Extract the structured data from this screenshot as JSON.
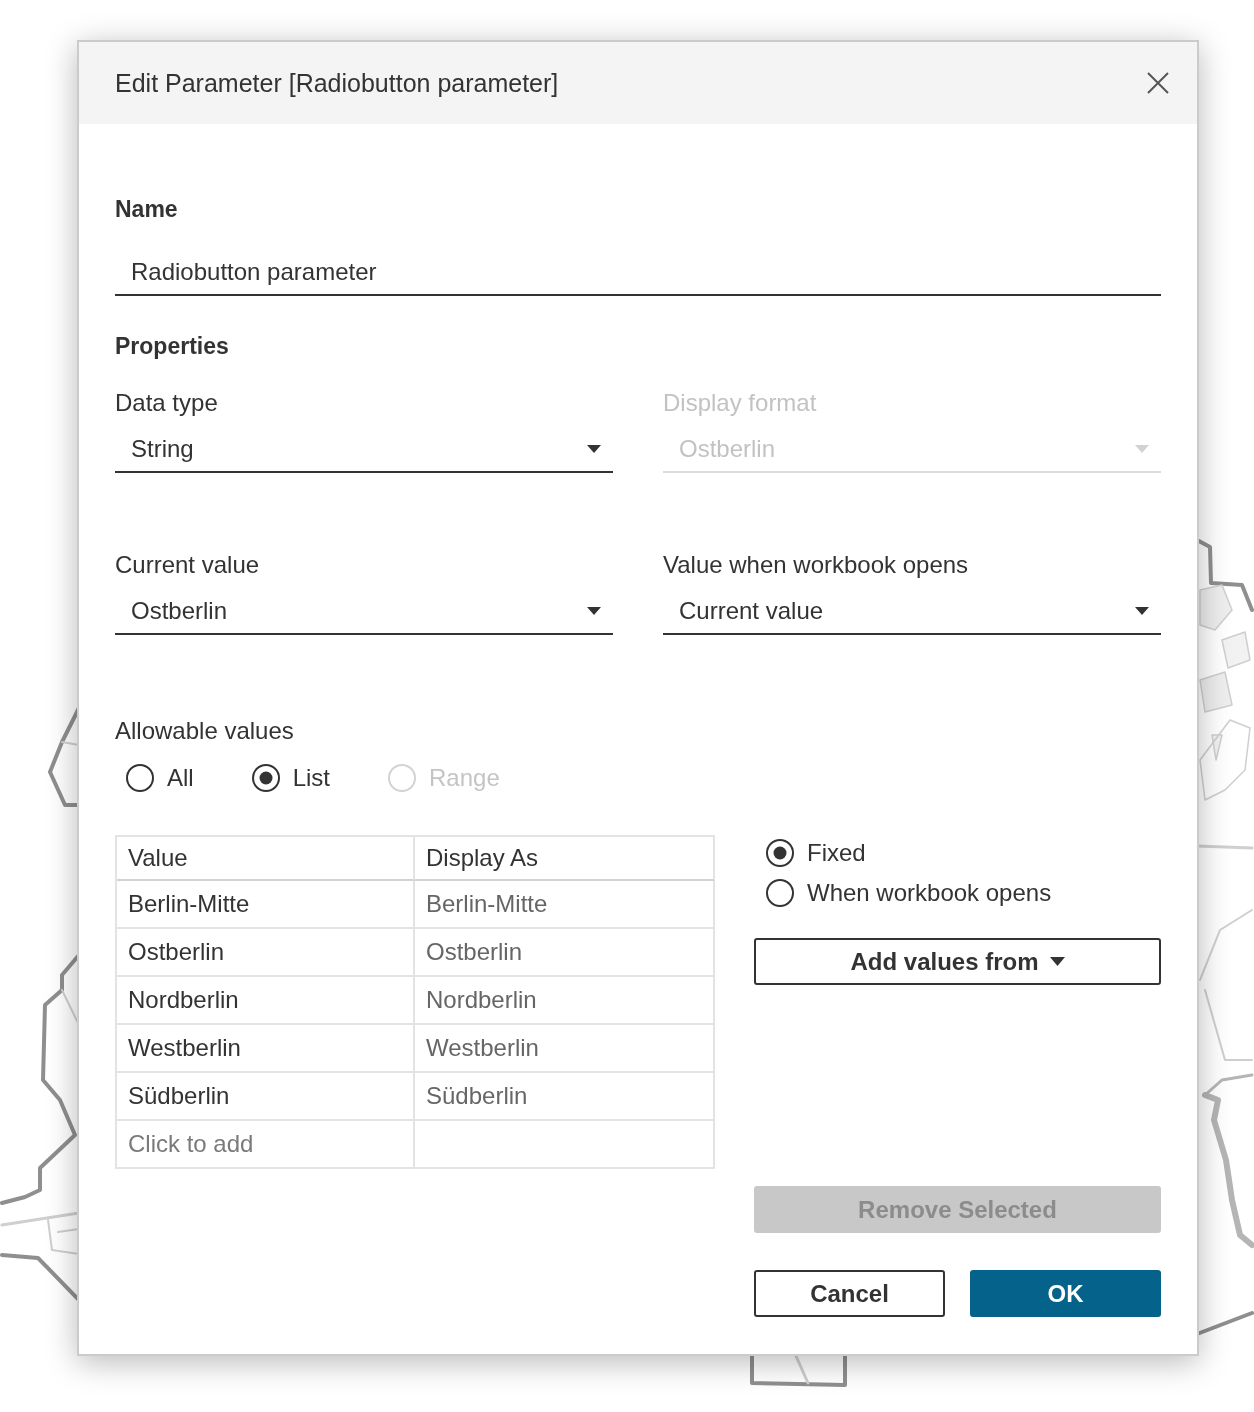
{
  "dialog": {
    "title": "Edit Parameter [Radiobutton parameter]"
  },
  "name_section": {
    "heading": "Name",
    "field": {
      "value": "Radiobutton parameter"
    }
  },
  "properties": {
    "heading": "Properties",
    "fields": [
      {
        "label": "Data type",
        "value": "String",
        "disabled": false
      },
      {
        "label": "Display format",
        "value": "Ostberlin",
        "disabled": true
      },
      {
        "label": "Current value",
        "value": "Ostberlin",
        "disabled": false
      },
      {
        "label": "Value when workbook opens",
        "value": "Current value",
        "disabled": false
      }
    ]
  },
  "allowable_values": {
    "label": "Allowable values",
    "options": [
      {
        "label": "All",
        "selected": false,
        "disabled": false
      },
      {
        "label": "List",
        "selected": true,
        "disabled": false
      },
      {
        "label": "Range",
        "selected": false,
        "disabled": true
      }
    ]
  },
  "table": {
    "columns": [
      "Value",
      "Display As"
    ],
    "rows": [
      {
        "value": "Berlin-Mitte",
        "display_as": "Berlin-Mitte"
      },
      {
        "value": "Ostberlin",
        "display_as": "Ostberlin"
      },
      {
        "value": "Nordberlin",
        "display_as": "Nordberlin"
      },
      {
        "value": "Westberlin",
        "display_as": "Westberlin"
      },
      {
        "value": "Südberlin",
        "display_as": "Südberlin"
      }
    ],
    "add_row": {
      "placeholder": "Click to add"
    }
  },
  "list_source": {
    "options": [
      {
        "label": "Fixed",
        "selected": true
      },
      {
        "label": "When workbook opens",
        "selected": false
      }
    ]
  },
  "add_values_button": {
    "label": "Add values from"
  },
  "remove_button": {
    "label": "Remove Selected",
    "disabled": true
  },
  "footer_buttons": [
    {
      "label": "Cancel",
      "kind": "secondary"
    },
    {
      "label": "OK",
      "kind": "primary"
    }
  ]
}
